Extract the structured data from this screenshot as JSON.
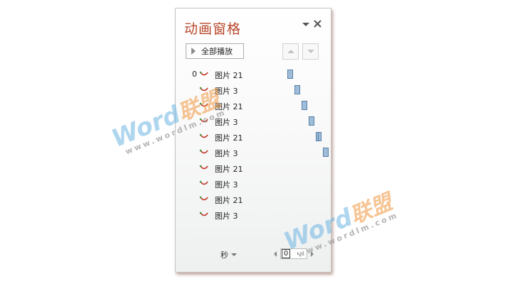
{
  "pane": {
    "title": "动画窗格",
    "play_all_label": "全部播放",
    "collapse_icon": "dropdown-arrow-icon",
    "close_glyph": "✕"
  },
  "animation_list": [
    {
      "num": "0",
      "name": "图片 21"
    },
    {
      "num": "",
      "name": "图片 3"
    },
    {
      "num": "",
      "name": "图片 21"
    },
    {
      "num": "",
      "name": "图片 3"
    },
    {
      "num": "",
      "name": "图片 21"
    },
    {
      "num": "",
      "name": "图片 3"
    },
    {
      "num": "",
      "name": "图片 21"
    },
    {
      "num": "",
      "name": "图片 3"
    },
    {
      "num": "",
      "name": "图片 21"
    },
    {
      "num": "",
      "name": "图片 3"
    }
  ],
  "footer": {
    "unit_label": "秒",
    "zoom_value": "0"
  },
  "watermark": {
    "brand": "Word",
    "brand_cn": "联盟",
    "url": "www.wordlm.com"
  },
  "colors": {
    "title": "#b7472a",
    "timeline_bar": "#9fbdd8",
    "timeline_bar_border": "#577fa6",
    "effect_icon_red": "#c0392b",
    "effect_icon_green": "#3a9a3a"
  }
}
